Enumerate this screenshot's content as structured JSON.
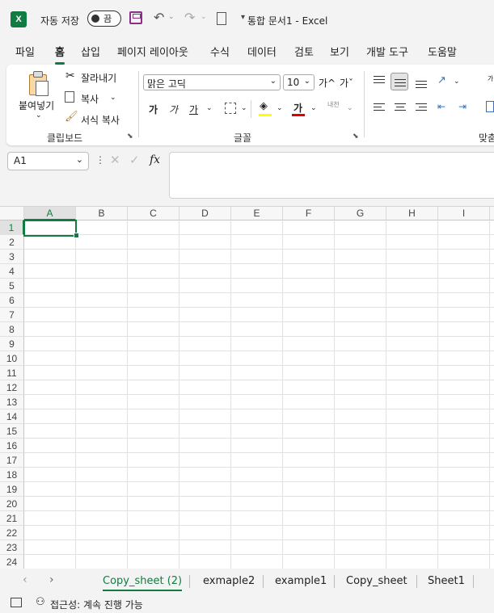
{
  "titlebar": {
    "logo": "X",
    "autosave_label": "자동 저장",
    "autosave_state": "끔",
    "document_title": "통합 문서1  -  Excel"
  },
  "menu_tabs": [
    "파일",
    "홈",
    "삽입",
    "페이지 레이아웃",
    "수식",
    "데이터",
    "검토",
    "보기",
    "개발 도구",
    "도움말"
  ],
  "ribbon": {
    "clipboard": {
      "paste_label": "붙여넣기",
      "cut_label": "잘라내기",
      "copy_label": "복사",
      "format_painter_label": "서식 복사",
      "group_label": "클립보드"
    },
    "font": {
      "font_name": "맑은 고딕",
      "font_size": "10",
      "grow_label": "가^",
      "shrink_label": "가ˇ",
      "bold_label": "가",
      "italic_label": "가",
      "underline_label": "가",
      "font_color_label": "가",
      "phonetic_label": "내천",
      "group_label": "글꼴"
    },
    "alignment": {
      "group_label": "맞춤",
      "wrap_label": "가"
    }
  },
  "formula_bar": {
    "name_box": "A1",
    "fx_label": "fx",
    "formula": ""
  },
  "grid": {
    "columns": [
      "A",
      "B",
      "C",
      "D",
      "E",
      "F",
      "G",
      "H",
      "I"
    ],
    "rows": [
      "1",
      "2",
      "3",
      "4",
      "5",
      "6",
      "7",
      "8",
      "9",
      "10",
      "11",
      "12",
      "13",
      "14",
      "15",
      "16",
      "17",
      "18",
      "19",
      "20",
      "21",
      "22",
      "23",
      "24"
    ],
    "selected_cell": "A1"
  },
  "sheet_tabs": [
    "Copy_sheet (2)",
    "exmaple2",
    "example1",
    "Copy_sheet",
    "Sheet1"
  ],
  "active_sheet": "Copy_sheet (2)",
  "status": {
    "accessibility": "접근성: 계속 진행 가능"
  },
  "colors": {
    "accent": "#107c41",
    "fill_yellow": "#ffff00",
    "font_red": "#e00000"
  }
}
